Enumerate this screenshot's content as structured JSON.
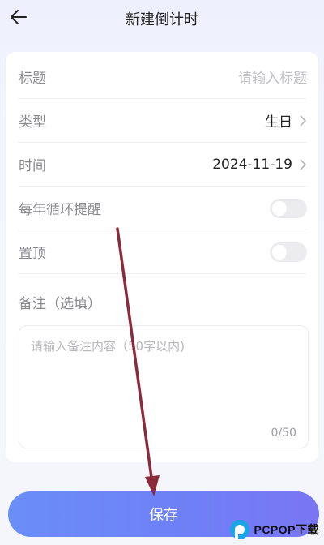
{
  "header": {
    "title": "新建倒计时"
  },
  "form": {
    "title_label": "标题",
    "title_placeholder": "请输入标题",
    "type_label": "类型",
    "type_value": "生日",
    "time_label": "时间",
    "time_value": "2024-11-19",
    "yearly_label": "每年循环提醒",
    "yearly_on": false,
    "pin_label": "置顶",
    "pin_on": false,
    "note_label": "备注（选填）",
    "note_placeholder": "请输入备注内容（50字以内)",
    "note_counter": "0/50"
  },
  "actions": {
    "save_label": "保存"
  },
  "watermark": {
    "text": "PCPOP下载"
  },
  "colors": {
    "accent": "#6f84f7",
    "arrow": "#8b2a3a"
  }
}
